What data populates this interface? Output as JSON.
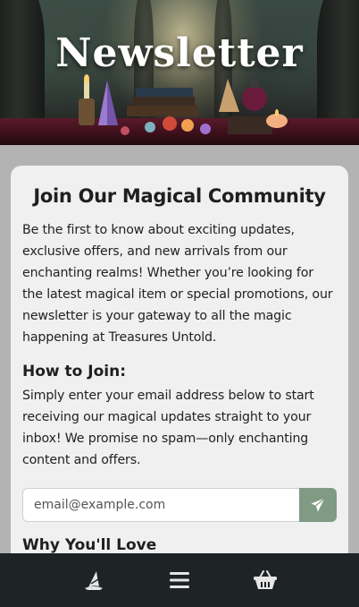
{
  "hero": {
    "title": "Newsletter"
  },
  "card": {
    "title": "Join Our Magical Community",
    "intro": "Be the first to know about exciting updates, exclusive offers, and new arrivals from our enchanting realms! Whether you’re looking for the latest magical item or special promotions, our newsletter is your gateway to all the magic happening at Treasures Untold.",
    "how_heading": "How to Join:",
    "how_text": "Simply enter your email address below to start receiving our magical updates straight to your inbox! We promise no spam—only enchanting content and offers.",
    "email_placeholder": "email@example.com",
    "next_heading": "Why You'll Love"
  },
  "nav": {
    "items": [
      {
        "icon": "wizard-hat-icon"
      },
      {
        "icon": "menu-icon"
      },
      {
        "icon": "basket-icon"
      }
    ]
  },
  "colors": {
    "accent": "#7f9b83",
    "nav_bg": "#1e2426",
    "card_bg": "#f0f0f1",
    "page_bg": "#b3b3b3"
  }
}
